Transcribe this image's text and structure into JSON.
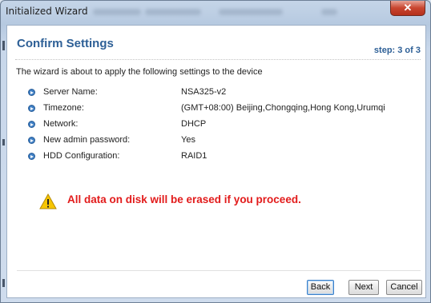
{
  "window": {
    "title": "Initialized Wizard",
    "close_glyph": "✕"
  },
  "header": {
    "title": "Confirm Settings",
    "step": "step: 3 of 3"
  },
  "intro": "The wizard is about to apply the following settings to the device",
  "settings": [
    {
      "label": "Server Name:",
      "value": "NSA325-v2"
    },
    {
      "label": "Timezone:",
      "value": "(GMT+08:00) Beijing,Chongqing,Hong Kong,Urumqi"
    },
    {
      "label": "Network:",
      "value": "DHCP"
    },
    {
      "label": "New admin password:",
      "value": "Yes"
    },
    {
      "label": "HDD Configuration:",
      "value": "RAID1"
    }
  ],
  "warning": {
    "text": "All data on disk will be erased if you proceed.",
    "color": "#e21b1b",
    "icon": "warning-icon"
  },
  "buttons": {
    "back": "Back",
    "next": "Next",
    "cancel": "Cancel"
  },
  "colors": {
    "accent": "#2d5f96",
    "bullet": "#3f7fc4",
    "close": "#c8452f"
  }
}
